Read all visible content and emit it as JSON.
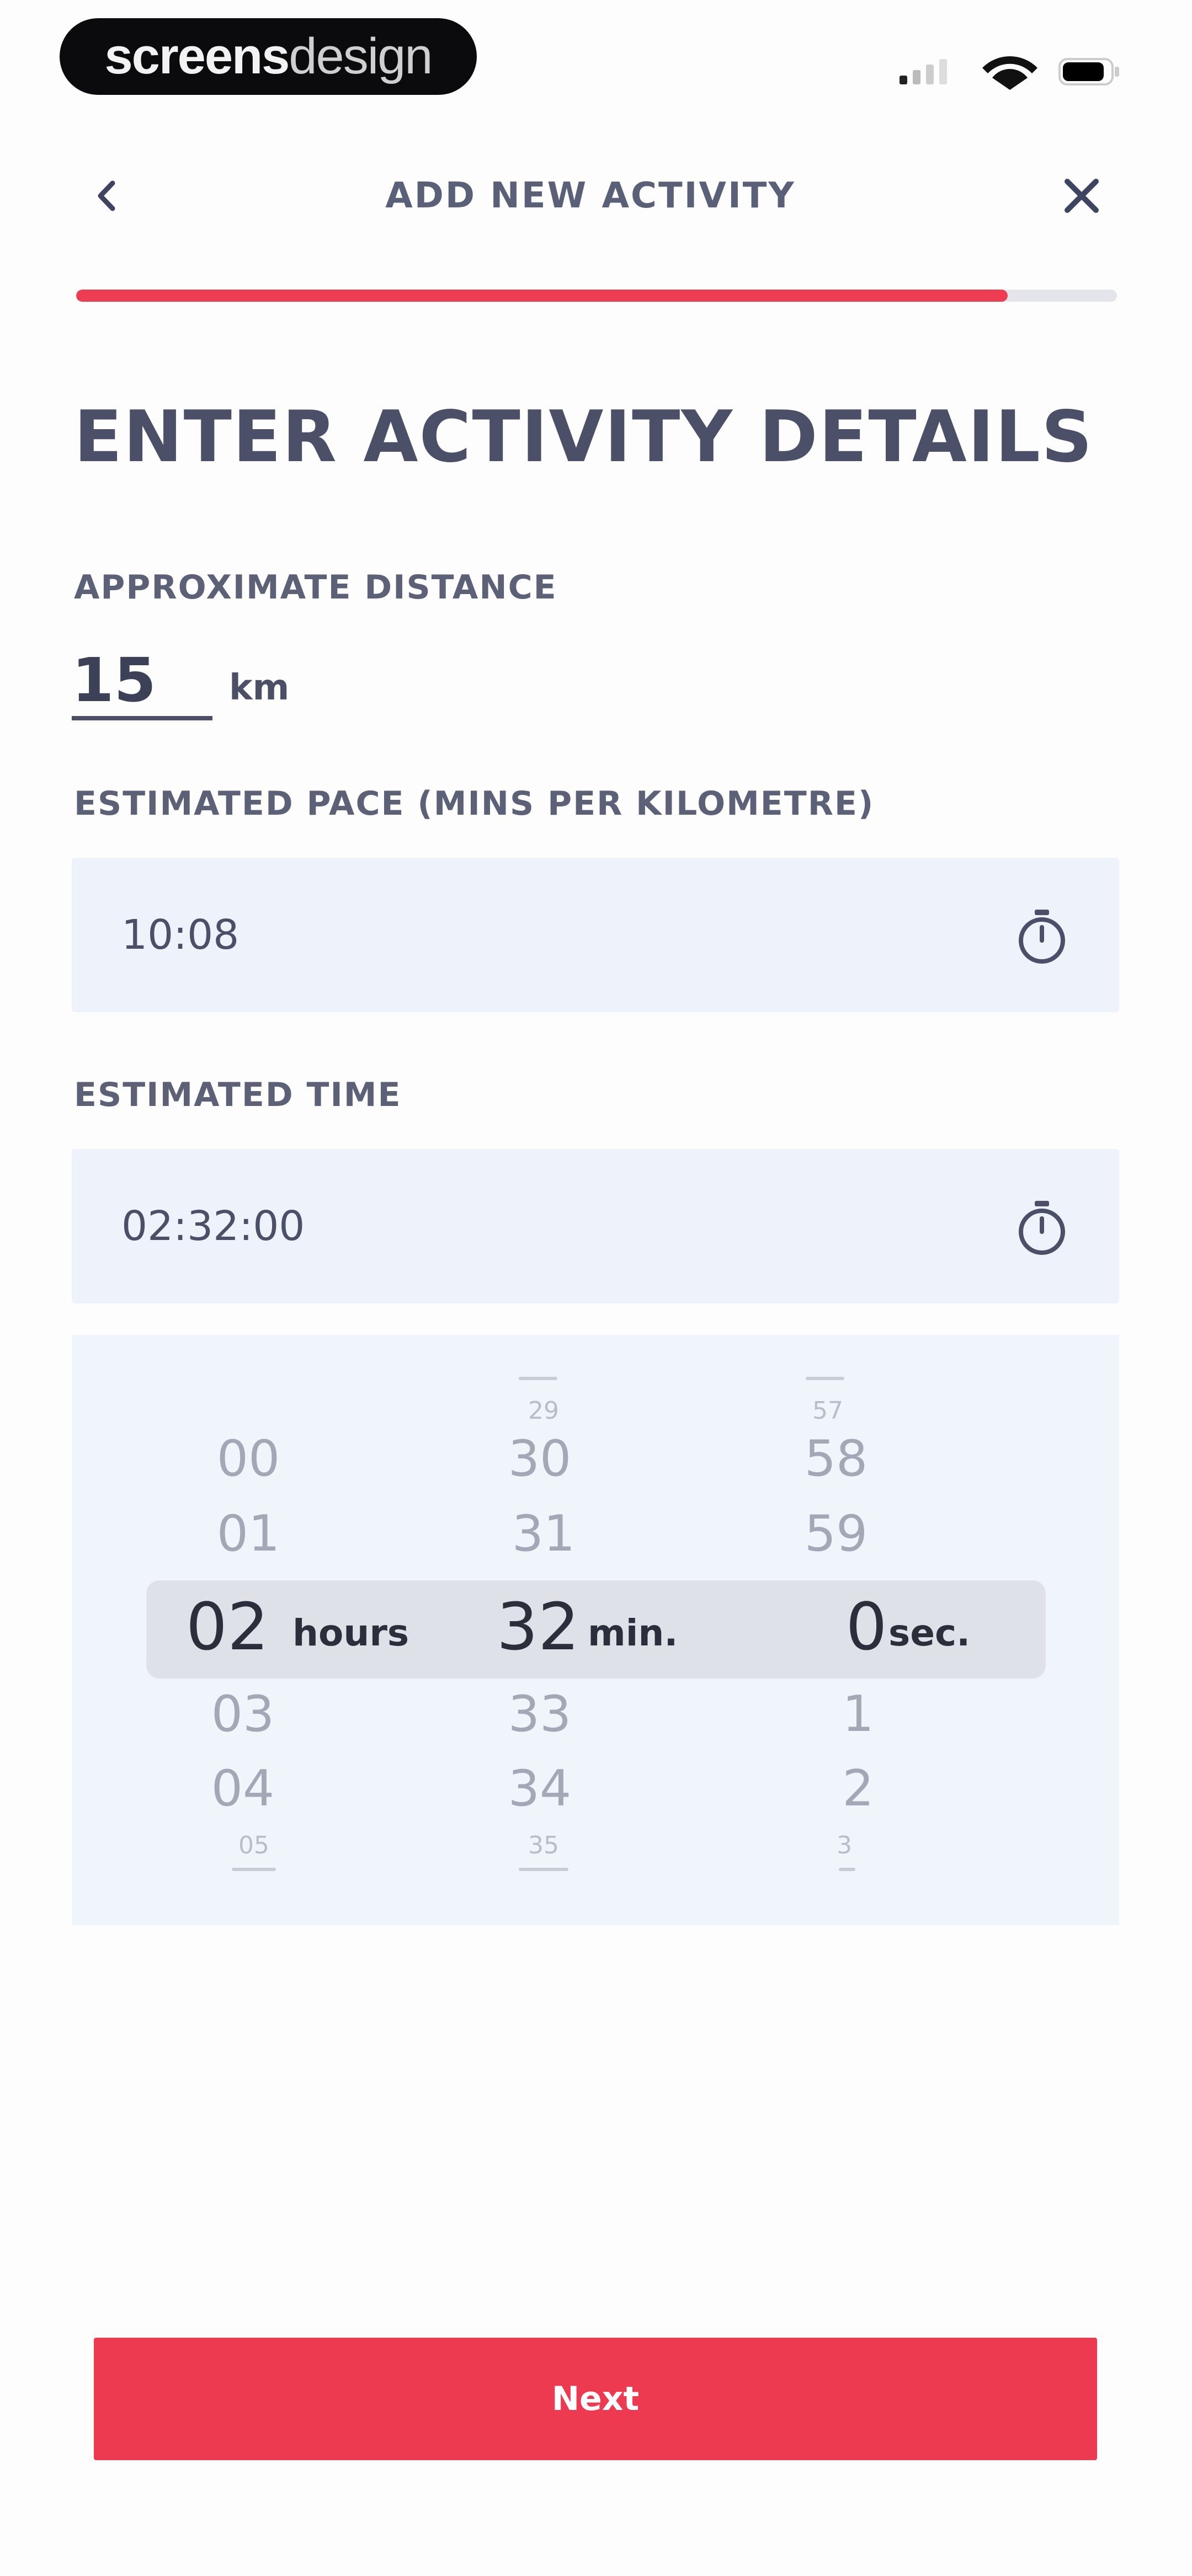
{
  "brand": {
    "part1": "screens",
    "part2": "design"
  },
  "header": {
    "title": "ADD NEW ACTIVITY",
    "back_icon": "chevron-left-icon",
    "close_icon": "close-icon",
    "progress": 0.895,
    "accent_color": "#ee3c52"
  },
  "main": {
    "title": "ENTER ACTIVITY DETAILS",
    "distance": {
      "label": "APPROXIMATE DISTANCE",
      "value": "15",
      "unit": "km"
    },
    "pace": {
      "label": "ESTIMATED PACE (MINS PER KILOMETRE)",
      "value": "10:08",
      "icon": "stopwatch-icon"
    },
    "time": {
      "label": "ESTIMATED TIME",
      "value": "02:32:00",
      "icon": "stopwatch-icon"
    }
  },
  "picker": {
    "hours": {
      "far_above": "",
      "above2": "00",
      "above1": "01",
      "selected": "02",
      "unit": "hours",
      "below1": "03",
      "below2": "04",
      "far_below": "05"
    },
    "minutes": {
      "far_above": "29",
      "above2": "30",
      "above1": "31",
      "selected": "32",
      "unit": "min.",
      "below1": "33",
      "below2": "34",
      "far_below": "35"
    },
    "seconds": {
      "far_above": "57",
      "above2": "58",
      "above1": "59",
      "selected": "0",
      "unit": "sec.",
      "below1": "1",
      "below2": "2",
      "far_below": "3"
    }
  },
  "footer": {
    "next_label": "Next"
  }
}
